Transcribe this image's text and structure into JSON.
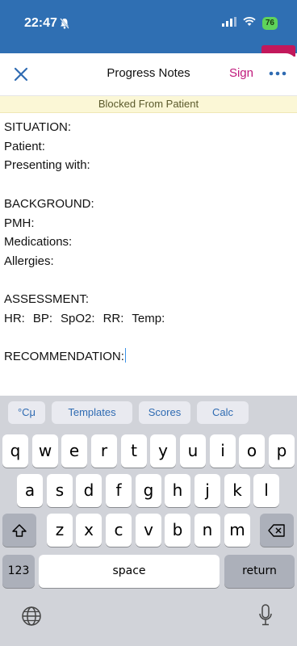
{
  "status": {
    "time": "22:47",
    "battery": "76"
  },
  "nav": {
    "title": "Progress Notes",
    "sign": "Sign"
  },
  "banner": "Blocked From Patient",
  "note": {
    "situation": "SITUATION:",
    "patient": "Patient:",
    "presenting": "Presenting with:",
    "background": "BACKGROUND:",
    "pmh": "PMH:",
    "medications": "Medications:",
    "allergies": "Allergies:",
    "assessment": "ASSESSMENT:",
    "vitals": [
      "HR:",
      "BP:",
      "SpO2:",
      "RR:",
      "Temp:"
    ],
    "recommendation": "RECOMMENDATION:"
  },
  "toolbar": {
    "units": "°Cμ",
    "templates": "Templates",
    "scores": "Scores",
    "calc": "Calc"
  },
  "keys": {
    "row1": [
      "q",
      "w",
      "e",
      "r",
      "t",
      "y",
      "u",
      "i",
      "o",
      "p"
    ],
    "row2": [
      "a",
      "s",
      "d",
      "f",
      "g",
      "h",
      "j",
      "k",
      "l"
    ],
    "row3": [
      "z",
      "x",
      "c",
      "v",
      "b",
      "n",
      "m"
    ],
    "numbers": "123",
    "space": "space",
    "return": "return"
  },
  "icons": [
    "bell-slash-icon",
    "signal-icon",
    "wifi-icon",
    "close-icon",
    "more-icon",
    "shift-icon",
    "backspace-icon",
    "globe-icon",
    "microphone-icon"
  ]
}
